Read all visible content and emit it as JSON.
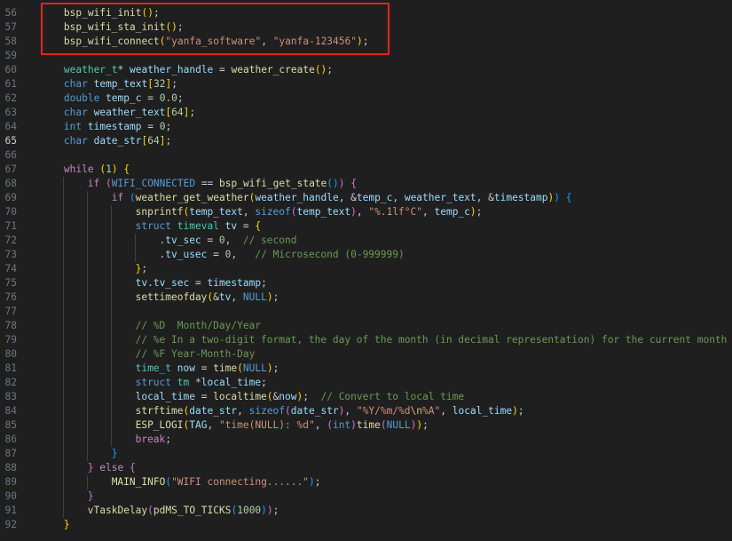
{
  "editor": {
    "colors": {
      "background": "#1f1f1f",
      "line_number": "#6e7681",
      "highlight_box": "#e0261c"
    },
    "active_line": 65,
    "lines": [
      {
        "n": 56,
        "indent": 1,
        "t": [
          [
            "fn",
            "bsp_wifi_init"
          ],
          [
            "b1",
            "()"
          ],
          [
            "p",
            ";"
          ]
        ]
      },
      {
        "n": 57,
        "indent": 1,
        "t": [
          [
            "fn",
            "bsp_wifi_sta_init"
          ],
          [
            "b1",
            "()"
          ],
          [
            "p",
            ";"
          ]
        ]
      },
      {
        "n": 58,
        "indent": 1,
        "t": [
          [
            "fn",
            "bsp_wifi_connect"
          ],
          [
            "b1",
            "("
          ],
          [
            "str",
            "\"yanfa_software\""
          ],
          [
            "p",
            ", "
          ],
          [
            "str",
            "\"yanfa-123456\""
          ],
          [
            "b1",
            ")"
          ],
          [
            "p",
            ";"
          ]
        ]
      },
      {
        "n": 59,
        "indent": 0,
        "t": []
      },
      {
        "n": 60,
        "indent": 1,
        "t": [
          [
            "ty",
            "weather_t"
          ],
          [
            "p",
            "* "
          ],
          [
            "var",
            "weather_handle"
          ],
          [
            "p",
            " = "
          ],
          [
            "fn",
            "weather_create"
          ],
          [
            "b1",
            "()"
          ],
          [
            "p",
            ";"
          ]
        ]
      },
      {
        "n": 61,
        "indent": 1,
        "t": [
          [
            "kw",
            "char"
          ],
          [
            "p",
            " "
          ],
          [
            "var",
            "temp_text"
          ],
          [
            "b1",
            "["
          ],
          [
            "num",
            "32"
          ],
          [
            "b1",
            "]"
          ],
          [
            "p",
            ";"
          ]
        ]
      },
      {
        "n": 62,
        "indent": 1,
        "t": [
          [
            "kw",
            "double"
          ],
          [
            "p",
            " "
          ],
          [
            "var",
            "temp_c"
          ],
          [
            "p",
            " = "
          ],
          [
            "num",
            "0.0"
          ],
          [
            "p",
            ";"
          ]
        ]
      },
      {
        "n": 63,
        "indent": 1,
        "t": [
          [
            "kw",
            "char"
          ],
          [
            "p",
            " "
          ],
          [
            "var",
            "weather_text"
          ],
          [
            "b1",
            "["
          ],
          [
            "num",
            "64"
          ],
          [
            "b1",
            "]"
          ],
          [
            "p",
            ";"
          ]
        ]
      },
      {
        "n": 64,
        "indent": 1,
        "t": [
          [
            "kw",
            "int"
          ],
          [
            "p",
            " "
          ],
          [
            "var",
            "timestamp"
          ],
          [
            "p",
            " = "
          ],
          [
            "num",
            "0"
          ],
          [
            "p",
            ";"
          ]
        ]
      },
      {
        "n": 65,
        "indent": 1,
        "t": [
          [
            "kw",
            "char"
          ],
          [
            "p",
            " "
          ],
          [
            "var",
            "date_str"
          ],
          [
            "b1",
            "["
          ],
          [
            "num",
            "64"
          ],
          [
            "b1",
            "]"
          ],
          [
            "p",
            ";"
          ]
        ]
      },
      {
        "n": 66,
        "indent": 0,
        "t": []
      },
      {
        "n": 67,
        "indent": 1,
        "t": [
          [
            "ctl",
            "while"
          ],
          [
            "p",
            " "
          ],
          [
            "b1",
            "("
          ],
          [
            "num",
            "1"
          ],
          [
            "b1",
            ")"
          ],
          [
            "p",
            " "
          ],
          [
            "b1",
            "{"
          ]
        ]
      },
      {
        "n": 68,
        "indent": 2,
        "t": [
          [
            "ctl",
            "if"
          ],
          [
            "p",
            " "
          ],
          [
            "b2",
            "("
          ],
          [
            "mac",
            "WIFI_CONNECTED"
          ],
          [
            "p",
            " == "
          ],
          [
            "fn",
            "bsp_wifi_get_state"
          ],
          [
            "b3",
            "()"
          ],
          [
            "b2",
            ")"
          ],
          [
            "p",
            " "
          ],
          [
            "b2",
            "{"
          ]
        ]
      },
      {
        "n": 69,
        "indent": 3,
        "t": [
          [
            "ctl",
            "if"
          ],
          [
            "p",
            " "
          ],
          [
            "b3",
            "("
          ],
          [
            "fn",
            "weather_get_weather"
          ],
          [
            "b1",
            "("
          ],
          [
            "var",
            "weather_handle"
          ],
          [
            "p",
            ", &"
          ],
          [
            "var",
            "temp_c"
          ],
          [
            "p",
            ", "
          ],
          [
            "var",
            "weather_text"
          ],
          [
            "p",
            ", &"
          ],
          [
            "var",
            "timestamp"
          ],
          [
            "b1",
            ")"
          ],
          [
            "b3",
            ")"
          ],
          [
            "p",
            " "
          ],
          [
            "b3",
            "{"
          ]
        ]
      },
      {
        "n": 70,
        "indent": 4,
        "t": [
          [
            "fn",
            "snprintf"
          ],
          [
            "b1",
            "("
          ],
          [
            "var",
            "temp_text"
          ],
          [
            "p",
            ", "
          ],
          [
            "kw",
            "sizeof"
          ],
          [
            "b2",
            "("
          ],
          [
            "var",
            "temp_text"
          ],
          [
            "b2",
            ")"
          ],
          [
            "p",
            ", "
          ],
          [
            "str",
            "\"%.1lf°C\""
          ],
          [
            "p",
            ", "
          ],
          [
            "var",
            "temp_c"
          ],
          [
            "b1",
            ")"
          ],
          [
            "p",
            ";"
          ]
        ]
      },
      {
        "n": 71,
        "indent": 4,
        "t": [
          [
            "kw",
            "struct"
          ],
          [
            "p",
            " "
          ],
          [
            "ty",
            "timeval"
          ],
          [
            "p",
            " "
          ],
          [
            "var",
            "tv"
          ],
          [
            "p",
            " = "
          ],
          [
            "b1",
            "{"
          ]
        ]
      },
      {
        "n": 72,
        "indent": 5,
        "t": [
          [
            "p",
            "."
          ],
          [
            "var",
            "tv_sec"
          ],
          [
            "p",
            " = "
          ],
          [
            "num",
            "0"
          ],
          [
            "p",
            ",  "
          ],
          [
            "cm",
            "// second"
          ]
        ]
      },
      {
        "n": 73,
        "indent": 5,
        "t": [
          [
            "p",
            "."
          ],
          [
            "var",
            "tv_usec"
          ],
          [
            "p",
            " = "
          ],
          [
            "num",
            "0"
          ],
          [
            "p",
            ",   "
          ],
          [
            "cm",
            "// Microsecond (0-999999)"
          ]
        ]
      },
      {
        "n": 74,
        "indent": 4,
        "t": [
          [
            "b1",
            "}"
          ],
          [
            "p",
            ";"
          ]
        ]
      },
      {
        "n": 75,
        "indent": 4,
        "t": [
          [
            "var",
            "tv"
          ],
          [
            "p",
            "."
          ],
          [
            "var",
            "tv_sec"
          ],
          [
            "p",
            " = "
          ],
          [
            "var",
            "timestamp"
          ],
          [
            "p",
            ";"
          ]
        ]
      },
      {
        "n": 76,
        "indent": 4,
        "t": [
          [
            "fn",
            "settimeofday"
          ],
          [
            "b1",
            "("
          ],
          [
            "p",
            "&"
          ],
          [
            "var",
            "tv"
          ],
          [
            "p",
            ", "
          ],
          [
            "mac",
            "NULL"
          ],
          [
            "b1",
            ")"
          ],
          [
            "p",
            ";"
          ]
        ]
      },
      {
        "n": 77,
        "indent": 0,
        "t": []
      },
      {
        "n": 78,
        "indent": 4,
        "t": [
          [
            "cm",
            "// %D  Month/Day/Year"
          ]
        ]
      },
      {
        "n": 79,
        "indent": 4,
        "t": [
          [
            "cm",
            "// %e In a two-digit format, the day of the month (in decimal representation) for the current month"
          ]
        ]
      },
      {
        "n": 80,
        "indent": 4,
        "t": [
          [
            "cm",
            "// %F Year-Month-Day"
          ]
        ]
      },
      {
        "n": 81,
        "indent": 4,
        "t": [
          [
            "ty",
            "time_t"
          ],
          [
            "p",
            " "
          ],
          [
            "var",
            "now"
          ],
          [
            "p",
            " = "
          ],
          [
            "fn",
            "time"
          ],
          [
            "b1",
            "("
          ],
          [
            "mac",
            "NULL"
          ],
          [
            "b1",
            ")"
          ],
          [
            "p",
            ";"
          ]
        ]
      },
      {
        "n": 82,
        "indent": 4,
        "t": [
          [
            "kw",
            "struct"
          ],
          [
            "p",
            " "
          ],
          [
            "ty",
            "tm"
          ],
          [
            "p",
            " *"
          ],
          [
            "var",
            "local_time"
          ],
          [
            "p",
            ";"
          ]
        ]
      },
      {
        "n": 83,
        "indent": 4,
        "t": [
          [
            "var",
            "local_time"
          ],
          [
            "p",
            " = "
          ],
          [
            "fn",
            "localtime"
          ],
          [
            "b1",
            "("
          ],
          [
            "p",
            "&"
          ],
          [
            "var",
            "now"
          ],
          [
            "b1",
            ")"
          ],
          [
            "p",
            ";  "
          ],
          [
            "cm",
            "// Convert to local time"
          ]
        ]
      },
      {
        "n": 84,
        "indent": 4,
        "t": [
          [
            "fn",
            "strftime"
          ],
          [
            "b1",
            "("
          ],
          [
            "var",
            "date_str"
          ],
          [
            "p",
            ", "
          ],
          [
            "kw",
            "sizeof"
          ],
          [
            "b2",
            "("
          ],
          [
            "var",
            "date_str"
          ],
          [
            "b2",
            ")"
          ],
          [
            "p",
            ", "
          ],
          [
            "str",
            "\"%Y/%m/%d"
          ],
          [
            "esc",
            "\\n"
          ],
          [
            "str",
            "%A\""
          ],
          [
            "p",
            ", "
          ],
          [
            "var",
            "local_time"
          ],
          [
            "b1",
            ")"
          ],
          [
            "p",
            ";"
          ]
        ]
      },
      {
        "n": 85,
        "indent": 4,
        "t": [
          [
            "fn",
            "ESP_LOGI"
          ],
          [
            "b1",
            "("
          ],
          [
            "var",
            "TAG"
          ],
          [
            "p",
            ", "
          ],
          [
            "str",
            "\"time(NULL): %d\""
          ],
          [
            "p",
            ", "
          ],
          [
            "b2",
            "("
          ],
          [
            "kw",
            "int"
          ],
          [
            "b2",
            ")"
          ],
          [
            "fn",
            "time"
          ],
          [
            "b2",
            "("
          ],
          [
            "mac",
            "NULL"
          ],
          [
            "b2",
            ")"
          ],
          [
            "b1",
            ")"
          ],
          [
            "p",
            ";"
          ]
        ]
      },
      {
        "n": 86,
        "indent": 4,
        "t": [
          [
            "ctl",
            "break"
          ],
          [
            "p",
            ";"
          ]
        ]
      },
      {
        "n": 87,
        "indent": 3,
        "t": [
          [
            "b3",
            "}"
          ]
        ]
      },
      {
        "n": 88,
        "indent": 2,
        "t": [
          [
            "b2",
            "}"
          ],
          [
            "p",
            " "
          ],
          [
            "ctl",
            "else"
          ],
          [
            "p",
            " "
          ],
          [
            "b2",
            "{"
          ]
        ]
      },
      {
        "n": 89,
        "indent": 3,
        "t": [
          [
            "fn",
            "MAIN_INFO"
          ],
          [
            "b3",
            "("
          ],
          [
            "str",
            "\"WIFI connecting......\""
          ],
          [
            "b3",
            ")"
          ],
          [
            "p",
            ";"
          ]
        ]
      },
      {
        "n": 90,
        "indent": 2,
        "t": [
          [
            "b2",
            "}"
          ]
        ]
      },
      {
        "n": 91,
        "indent": 2,
        "t": [
          [
            "fn",
            "vTaskDelay"
          ],
          [
            "b2",
            "("
          ],
          [
            "fn",
            "pdMS_TO_TICKS"
          ],
          [
            "b3",
            "("
          ],
          [
            "num",
            "1000"
          ],
          [
            "b3",
            ")"
          ],
          [
            "b2",
            ")"
          ],
          [
            "p",
            ";"
          ]
        ]
      },
      {
        "n": 92,
        "indent": 1,
        "t": [
          [
            "b1",
            "}"
          ]
        ]
      }
    ]
  }
}
